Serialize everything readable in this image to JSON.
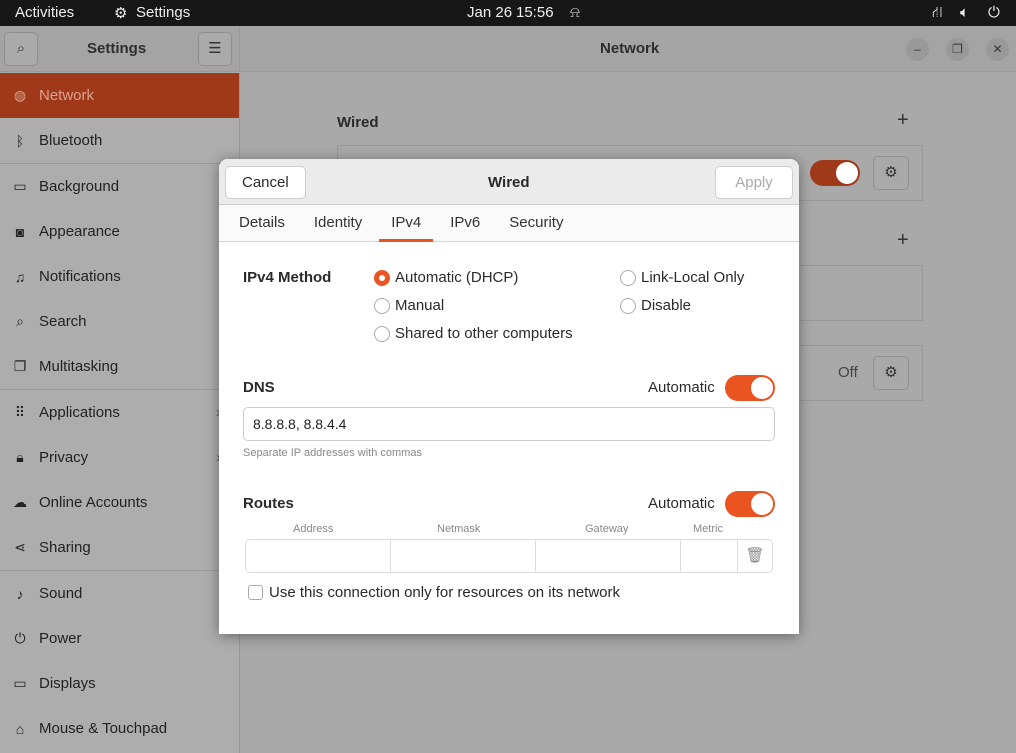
{
  "topbar": {
    "activities": "Activities",
    "app": "Settings",
    "date": "Jan 26",
    "time": "15:56"
  },
  "header": {
    "sidebar_title": "Settings",
    "title": "Network"
  },
  "sidebar": {
    "items": [
      {
        "label": "Network",
        "icon": "globe-icon",
        "glyph": "◍"
      },
      {
        "label": "Bluetooth",
        "icon": "bluetooth-icon",
        "glyph": "ᛒ"
      },
      {
        "label": "Background",
        "icon": "monitor-icon",
        "glyph": "▭"
      },
      {
        "label": "Appearance",
        "icon": "appearance-icon",
        "glyph": "◙"
      },
      {
        "label": "Notifications",
        "icon": "bell-icon",
        "glyph": "♫"
      },
      {
        "label": "Search",
        "icon": "search-icon",
        "glyph": "⌕"
      },
      {
        "label": "Multitasking",
        "icon": "multitasking-icon",
        "glyph": "❐"
      },
      {
        "label": "Applications",
        "icon": "grid-icon",
        "glyph": "⠿"
      },
      {
        "label": "Privacy",
        "icon": "lock-icon",
        "glyph": "🔒︎"
      },
      {
        "label": "Online Accounts",
        "icon": "cloud-icon",
        "glyph": "☁"
      },
      {
        "label": "Sharing",
        "icon": "share-icon",
        "glyph": "⋖"
      },
      {
        "label": "Sound",
        "icon": "music-icon",
        "glyph": "♪"
      },
      {
        "label": "Power",
        "icon": "power-icon",
        "glyph": "⏻"
      },
      {
        "label": "Displays",
        "icon": "display-icon",
        "glyph": "▭"
      },
      {
        "label": "Mouse & Touchpad",
        "icon": "mouse-icon",
        "glyph": "⌂"
      }
    ]
  },
  "main": {
    "wired_heading": "Wired",
    "off_label": "Off"
  },
  "dialog": {
    "title": "Wired",
    "cancel": "Cancel",
    "apply": "Apply",
    "tabs": [
      "Details",
      "Identity",
      "IPv4",
      "IPv6",
      "Security"
    ],
    "active_tab": "IPv4",
    "method_label": "IPv4 Method",
    "methods": {
      "auto": "Automatic (DHCP)",
      "manual": "Manual",
      "shared": "Shared to other computers",
      "link_local": "Link-Local Only",
      "disable": "Disable"
    },
    "selected_method": "Automatic (DHCP)",
    "dns_label": "DNS",
    "dns_auto_label": "Automatic",
    "dns_auto": true,
    "dns_value": "8.8.8.8, 8.8.4.4",
    "dns_hint": "Separate IP addresses with commas",
    "routes_label": "Routes",
    "routes_auto_label": "Automatic",
    "routes_auto": true,
    "route_columns": [
      "Address",
      "Netmask",
      "Gateway",
      "Metric"
    ],
    "only_resources": "Use this connection only for resources on its network"
  }
}
